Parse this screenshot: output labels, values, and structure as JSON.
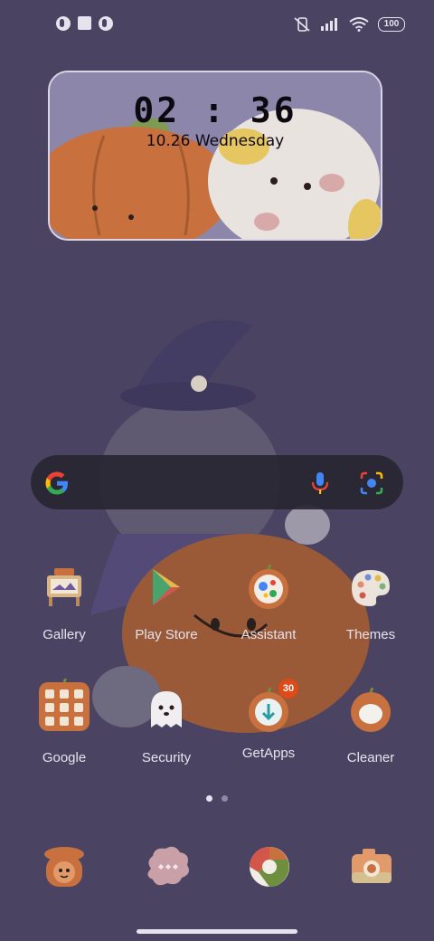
{
  "status_bar": {
    "battery": "100",
    "icons": [
      "notification-icon-1",
      "notification-icon-2",
      "notification-icon-3",
      "mute-icon",
      "signal-icon",
      "wifi-icon",
      "battery-icon"
    ]
  },
  "clock_widget": {
    "time": "02 : 36",
    "date": "10.26  Wednesday"
  },
  "search_bar": {
    "icons": [
      "google-g-icon",
      "microphone-icon",
      "lens-camera-icon"
    ]
  },
  "apps_row1": [
    {
      "label": "Gallery",
      "icon": "gallery-icon"
    },
    {
      "label": "Play Store",
      "icon": "play-store-icon"
    },
    {
      "label": "Assistant",
      "icon": "assistant-icon"
    },
    {
      "label": "Themes",
      "icon": "themes-icon"
    }
  ],
  "apps_row2": [
    {
      "label": "Google",
      "icon": "google-folder-icon"
    },
    {
      "label": "Security",
      "icon": "security-icon"
    },
    {
      "label": "GetApps",
      "icon": "getapps-icon",
      "badge": "30"
    },
    {
      "label": "Cleaner",
      "icon": "cleaner-icon"
    }
  ],
  "page_indicator": {
    "pages": 2,
    "active": 0
  },
  "dock": [
    {
      "icon": "phone-icon"
    },
    {
      "icon": "messages-icon"
    },
    {
      "icon": "browser-icon"
    },
    {
      "icon": "camera-icon"
    }
  ]
}
